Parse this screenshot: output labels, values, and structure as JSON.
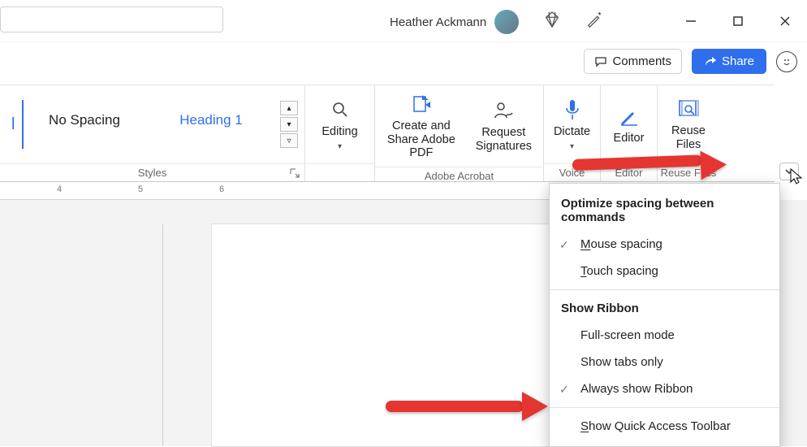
{
  "title": {
    "user_name": "Heather Ackmann"
  },
  "actions": {
    "comments_label": "Comments",
    "share_label": "Share"
  },
  "ribbon": {
    "styles": {
      "label": "Styles",
      "no_spacing": "No Spacing",
      "heading1": "Heading 1"
    },
    "editing": {
      "label": "Editing"
    },
    "acrobat": {
      "label": "Adobe Acrobat",
      "create_share": "Create and Share Adobe PDF",
      "request_sig": "Request Signatures"
    },
    "voice": {
      "label": "Voice",
      "dictate": "Dictate"
    },
    "editor": {
      "label": "Editor",
      "editor_btn": "Editor"
    },
    "reuse": {
      "label": "Reuse Files",
      "reuse_btn": "Reuse Files"
    }
  },
  "ruler": {
    "n4": "4",
    "n5": "5",
    "n6": "6"
  },
  "dropdown": {
    "section1": "Optimize spacing between commands",
    "mouse": "ouse spacing",
    "mouse_u": "M",
    "touch": "ouch spacing",
    "touch_u": "T",
    "section2": "Show Ribbon",
    "full": "Full-screen mode",
    "tabs": "Show tabs only",
    "always": "Always show Ribbon",
    "qat": "how Quick Access Toolbar",
    "qat_u": "S"
  }
}
